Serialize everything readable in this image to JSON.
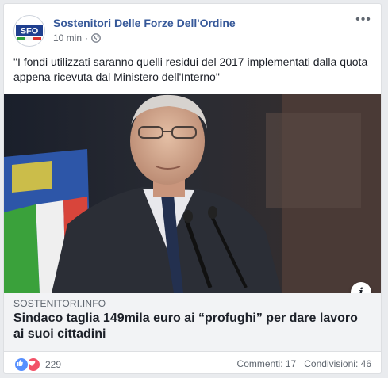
{
  "post": {
    "page_name": "Sostenitori Delle Forze Dell'Ordine",
    "timestamp": "10 min",
    "separator": "·",
    "privacy_icon": "globe-icon",
    "more_icon": "more-options-icon",
    "more_label": "•••",
    "text": "\"I fondi utilizzati saranno quelli residui del 2017 implementati dalla quota appena ricevuta dal Ministero dell'Interno\"",
    "avatar_text": "SFO"
  },
  "link_preview": {
    "domain": "SOSTENITORI.INFO",
    "title": "Sindaco taglia 149mila euro ai “profughi” per dare lavoro ai suoi cittadini",
    "info_label": "i"
  },
  "footer": {
    "reaction_count": "229",
    "comments_label": "Commenti:",
    "comments_count": "17",
    "shares_label": "Condivisioni:",
    "shares_count": "46"
  },
  "colors": {
    "page_name": "#365899",
    "like": "#5890ff",
    "love": "#f25268",
    "link_bg": "#f2f3f5"
  }
}
